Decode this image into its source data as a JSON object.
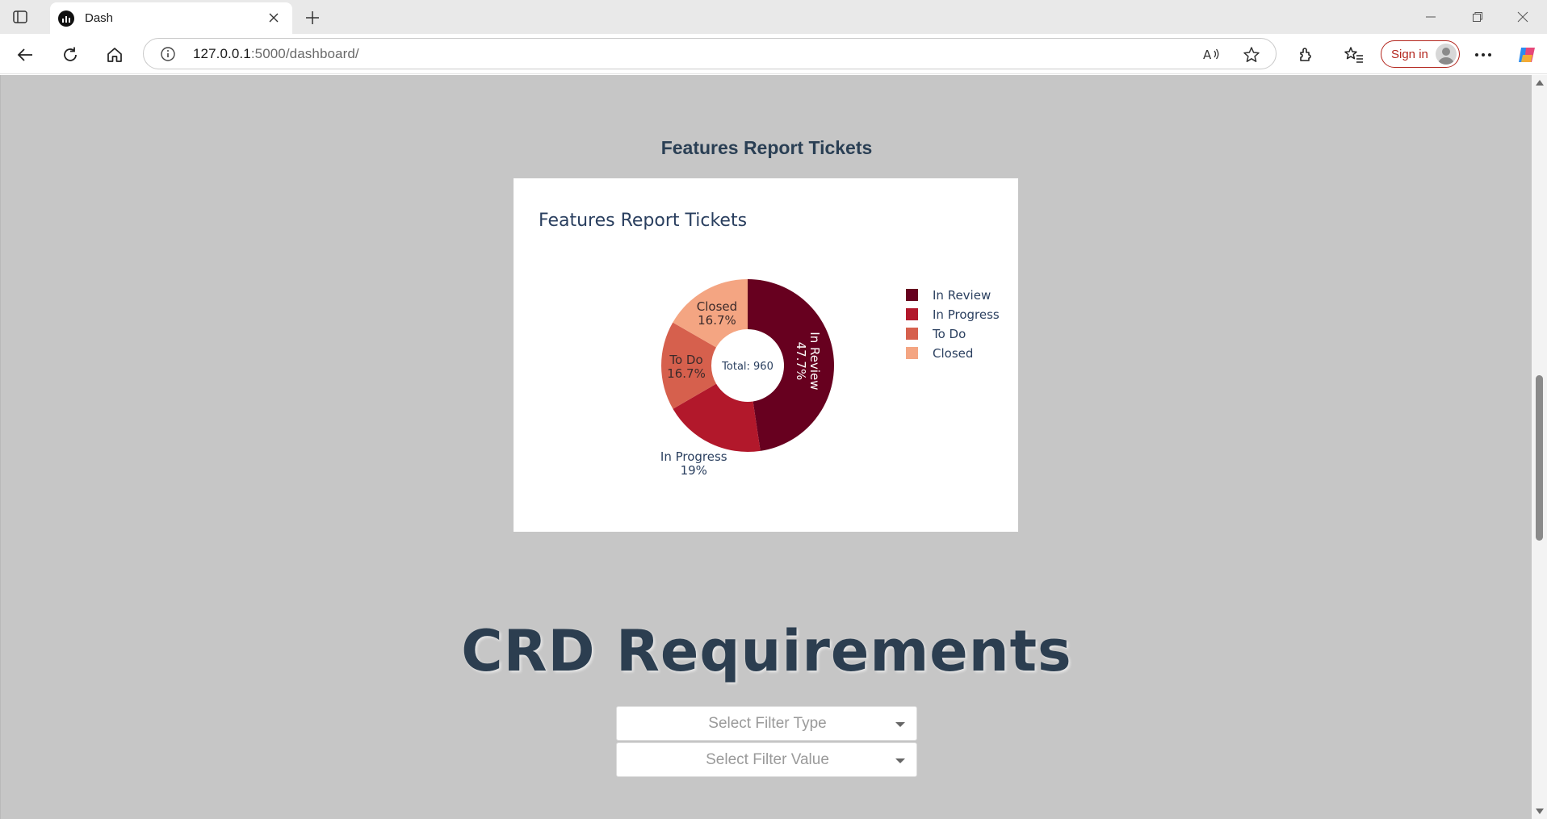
{
  "browser": {
    "tab": {
      "title": "Dash"
    },
    "address": {
      "host": "127.0.0.1",
      "path": ":5000/dashboard/"
    },
    "signin_label": "Sign in"
  },
  "page": {
    "section_title": "Features Report Tickets",
    "crd_title": "CRD Requirements",
    "filters": {
      "type_placeholder": "Select Filter Type",
      "value_placeholder": "Select Filter Value"
    }
  },
  "chart_data": {
    "type": "pie",
    "title": "Features Report Tickets",
    "hole_label": "Total: 960",
    "categories": [
      "In Review",
      "In Progress",
      "To Do",
      "Closed"
    ],
    "values": [
      47.7,
      19,
      16.7,
      16.7
    ],
    "value_labels": [
      "47.7%",
      "19%",
      "16.7%",
      "16.7%"
    ],
    "colors": [
      "#67001f",
      "#b2182b",
      "#d6604d",
      "#f4a582"
    ],
    "legend": {
      "position": "right",
      "entries": [
        "In Review",
        "In Progress",
        "To Do",
        "Closed"
      ]
    }
  }
}
